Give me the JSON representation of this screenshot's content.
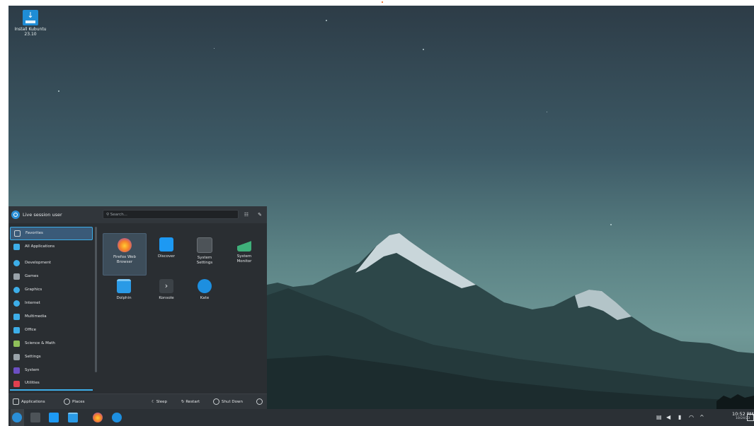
{
  "desktop": {
    "icon_label_line1": "Install Kubuntu",
    "icon_label_line2": "23.10"
  },
  "menu": {
    "user_name": "Live session user",
    "search_placeholder": "Search...",
    "categories": [
      {
        "label": "Favorites",
        "color": "#3a5a78"
      },
      {
        "label": "All Applications",
        "color": "#3daee9"
      },
      {
        "label": "Development",
        "color": "#3daee9"
      },
      {
        "label": "Games",
        "color": "#9aa3aa"
      },
      {
        "label": "Graphics",
        "color": "#3daee9"
      },
      {
        "label": "Internet",
        "color": "#3daee9"
      },
      {
        "label": "Multimedia",
        "color": "#3daee9"
      },
      {
        "label": "Office",
        "color": "#3daee9"
      },
      {
        "label": "Science & Math",
        "color": "#8fbf5a"
      },
      {
        "label": "Settings",
        "color": "#9aa3aa"
      },
      {
        "label": "System",
        "color": "#6c4fc4"
      },
      {
        "label": "Utilities",
        "color": "#e0404f"
      }
    ],
    "apps": [
      {
        "label_line1": "Firefox Web",
        "label_line2": "Browser",
        "icon": "firefox-icon",
        "color": "#f5812a"
      },
      {
        "label_line1": "Discover",
        "label_line2": "",
        "icon": "discover-icon",
        "color": "#1d99f3"
      },
      {
        "label_line1": "System",
        "label_line2": "Settings",
        "icon": "system-settings-icon",
        "color": "#4d5358"
      },
      {
        "label_line1": "System",
        "label_line2": "Monitor",
        "icon": "system-monitor-icon",
        "color": "#3a8a5a"
      },
      {
        "label_line1": "Dolphin",
        "label_line2": "",
        "icon": "dolphin-icon",
        "color": "#2a9ae6"
      },
      {
        "label_line1": "Konsole",
        "label_line2": "",
        "icon": "konsole-icon",
        "color": "#3c4247"
      },
      {
        "label_line1": "Kate",
        "label_line2": "",
        "icon": "kate-icon",
        "color": "#1d8fe0"
      }
    ],
    "footer": {
      "applications": "Applications",
      "places": "Places",
      "sleep": "Sleep",
      "restart": "Restart",
      "shutdown": "Shut Down"
    }
  },
  "taskbar": {
    "time": "10:52 PM",
    "date": "10/24/23"
  }
}
